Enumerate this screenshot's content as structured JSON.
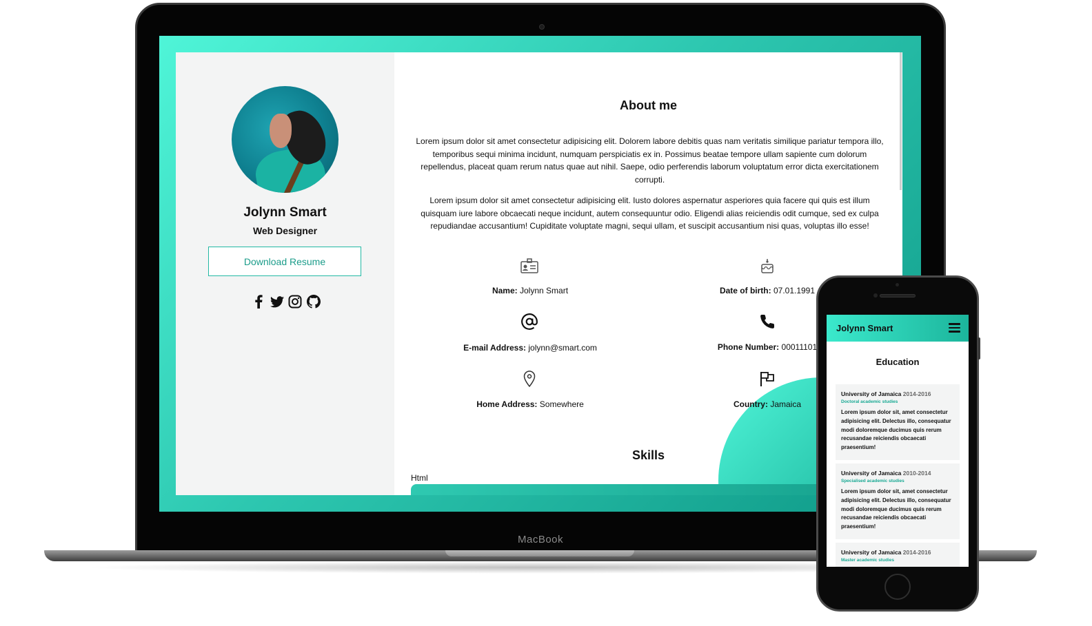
{
  "laptop": {
    "brand_label": "MacBook",
    "sidebar": {
      "name": "Jolynn Smart",
      "role": "Web Designer",
      "download_label": "Download Resume",
      "social_icons": [
        "facebook-icon",
        "twitter-icon",
        "instagram-icon",
        "github-icon"
      ]
    },
    "about": {
      "title": "About me",
      "paragraphs": [
        "Lorem ipsum dolor sit amet consectetur adipisicing elit. Dolorem labore debitis quas nam veritatis similique pariatur tempora illo, temporibus sequi minima incidunt, numquam perspiciatis ex in. Possimus beatae tempore ullam sapiente cum dolorum repellendus, placeat quam rerum natus quae aut nihil. Saepe, odio perferendis laborum voluptatum error dicta exercitationem corrupti.",
        "Lorem ipsum dolor sit amet consectetur adipisicing elit. Iusto dolores aspernatur asperiores quia facere qui quis est illum quisquam iure labore obcaecati neque incidunt, autem consequuntur odio. Eligendi alias reiciendis odit cumque, sed ex culpa repudiandae accusantium! Cupiditate voluptate magni, sequi ullam, et suscipit accusantium nisi quas, voluptas illo esse!"
      ]
    },
    "info": [
      {
        "label": "Name:",
        "value": "Jolynn Smart",
        "icon": "id-card-icon"
      },
      {
        "label": "Date of birth:",
        "value": "07.01.1991",
        "icon": "birthday-cake-icon"
      },
      {
        "label": "E-mail Address:",
        "value": "jolynn@smart.com",
        "icon": "at-sign-icon"
      },
      {
        "label": "Phone Number:",
        "value": "00011101",
        "icon": "phone-icon"
      },
      {
        "label": "Home Address:",
        "value": "Somewhere",
        "icon": "map-pin-icon"
      },
      {
        "label": "Country:",
        "value": "Jamaica",
        "icon": "flag-icon"
      }
    ],
    "skills": {
      "title": "Skills",
      "items": [
        {
          "name": "Html"
        }
      ]
    }
  },
  "phone": {
    "header_title": "Jolynn Smart",
    "section_title": "Education",
    "education": [
      {
        "school": "University of Jamaica",
        "years": "2014-2016",
        "type": "Doctoral academic studies",
        "description": "Lorem ipsum dolor sit, amet consectetur adipisicing elit. Delectus illo, consequatur modi doloremque ducimus quis rerum recusandae reiciendis obcaecati praesentium!"
      },
      {
        "school": "University of Jamaica",
        "years": "2010-2014",
        "type": "Specialised academic studies",
        "description": "Lorem ipsum dolor sit, amet consectetur adipisicing elit. Delectus illo, consequatur modi doloremque ducimus quis rerum recusandae reiciendis obcaecati praesentium!"
      },
      {
        "school": "University of Jamaica",
        "years": "2014-2016",
        "type": "Master academic studies",
        "description": ""
      }
    ]
  },
  "colors": {
    "accent": "#22b8a3",
    "accent_light": "#4ff5d8",
    "accent_dark": "#0f9a88",
    "sidebar_bg": "#f3f4f4"
  }
}
